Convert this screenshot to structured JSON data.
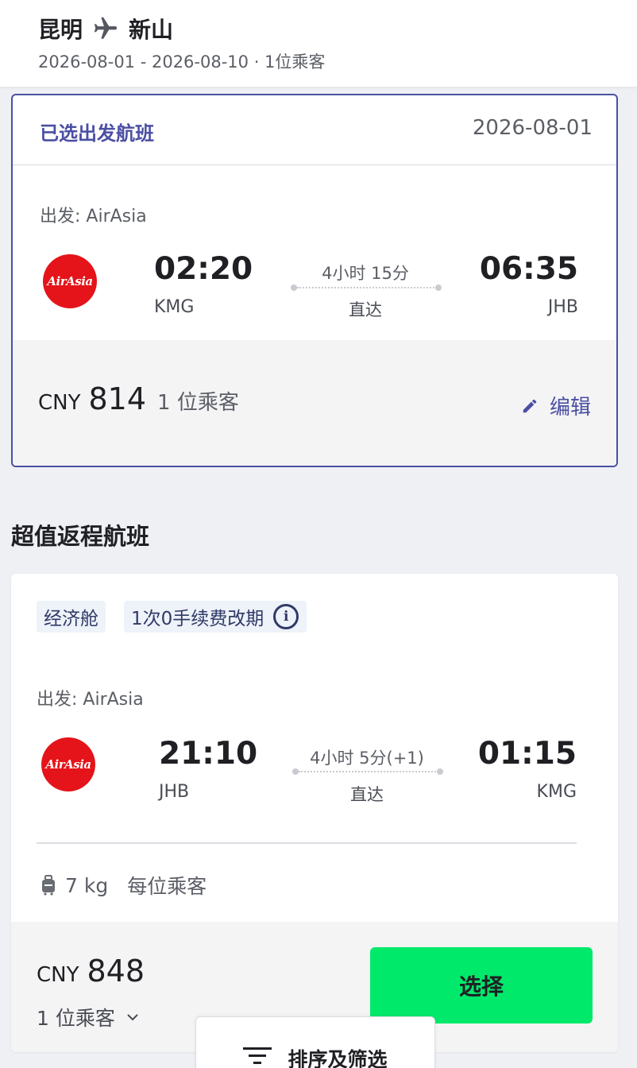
{
  "header": {
    "origin": "昆明",
    "destination": "新山",
    "subtitle": "2026-08-01 - 2026-08-10 · 1位乘客"
  },
  "selected": {
    "title": "已选出发航班",
    "date": "2026-08-01",
    "airline_label": "出发: AirAsia",
    "logo_text": "AirAsia",
    "dep_time": "02:20",
    "dep_code": "KMG",
    "duration": "4小时 15分",
    "stops": "直达",
    "arr_time": "06:35",
    "arr_code": "JHB",
    "currency": "CNY",
    "price": "814",
    "passengers": "1 位乘客",
    "edit_label": "编辑"
  },
  "section_title": "超值返程航班",
  "return_flight": {
    "cabin_tag": "经济舱",
    "change_tag": "1次0手续费改期",
    "info_glyph": "i",
    "airline_label": "出发: AirAsia",
    "logo_text": "AirAsia",
    "dep_time": "21:10",
    "dep_code": "JHB",
    "duration": "4小时 5分(+1)",
    "stops": "直达",
    "arr_time": "01:15",
    "arr_code": "KMG",
    "baggage_weight": "7 kg",
    "baggage_unit": "每位乘客",
    "currency": "CNY",
    "price": "848",
    "passengers": "1 位乘客",
    "select_label": "选择"
  },
  "sort_filter_label": "排序及筛选",
  "colors": {
    "accent": "#4b4fa3",
    "select_button": "#00e96a",
    "airasia_red": "#e4141a"
  },
  "icons": [
    "plane-icon",
    "pencil-icon",
    "info-icon",
    "luggage-icon",
    "chevron-down-icon",
    "filter-icon"
  ]
}
